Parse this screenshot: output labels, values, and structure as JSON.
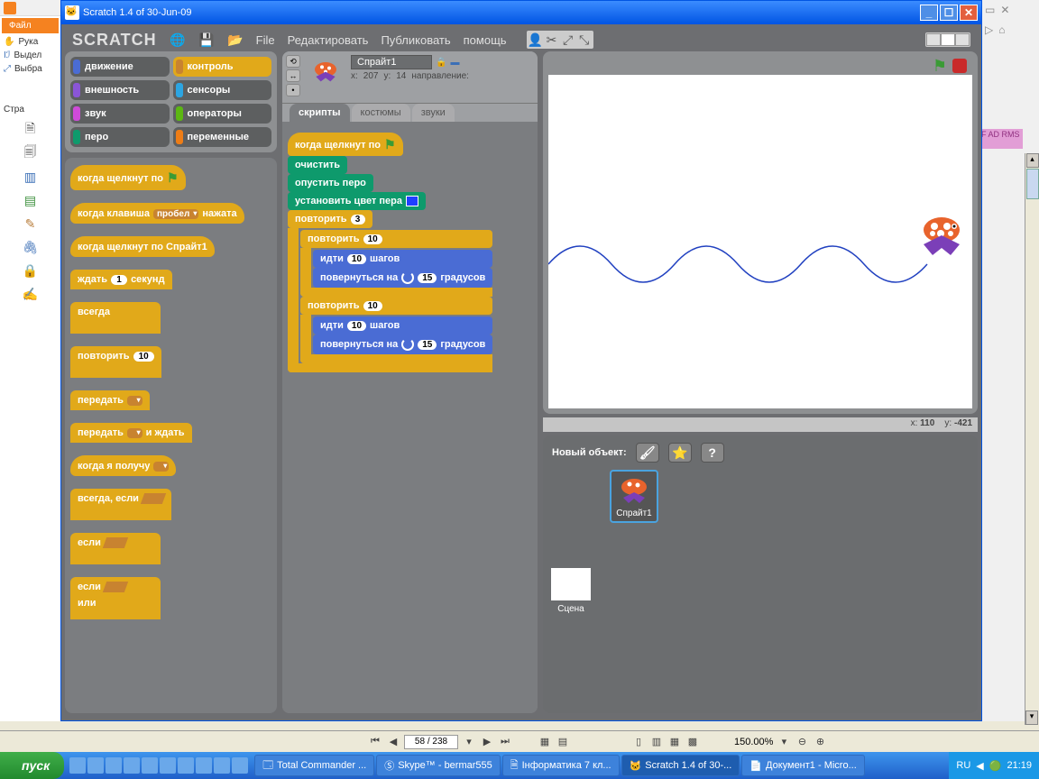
{
  "window": {
    "title": "Scratch 1.4 of 30-Jun-09"
  },
  "menubar": {
    "logo": "SCRATCH",
    "items": [
      "File",
      "Редактировать",
      "Публиковать",
      "помощь"
    ]
  },
  "categories": {
    "motion": "движение",
    "looks": "внешность",
    "sound": "звук",
    "pen": "перо",
    "control": "контроль",
    "sensing": "сенсоры",
    "operators": "операторы",
    "variables": "переменные"
  },
  "blocks": {
    "when_flag": "когда щелкнут по",
    "when_key": "когда клавиша",
    "when_key_key": "пробел",
    "when_key_suffix": "нажата",
    "when_sprite": "когда щелкнут по  Спрайт1",
    "wait": "ждать",
    "wait_n": "1",
    "wait_unit": "секунд",
    "forever": "всегда",
    "repeat": "повторить",
    "repeat_n": "10",
    "broadcast": "передать",
    "broadcast_wait": "передать",
    "broadcast_wait_suffix": "и ждать",
    "when_receive": "когда я получу",
    "forever_if": "всегда, если",
    "if": "если",
    "or": "или"
  },
  "sprite": {
    "name": "Спрайт1",
    "x_label": "x:",
    "x": "207",
    "y_label": "y:",
    "y": "14",
    "direction_label": "направление:"
  },
  "tabs": {
    "scripts": "скрипты",
    "costumes": "костюмы",
    "sounds": "звуки"
  },
  "script_stack": {
    "hat": "когда щелкнут по",
    "clear": "очистить",
    "pen_down": "опустить перо",
    "set_color": "установить цвет пера",
    "repeat_outer": "повторить",
    "repeat_outer_n": "3",
    "repeat1": "повторить",
    "repeat1_n": "10",
    "move": "идти",
    "move_n": "10",
    "move_unit": "шагов",
    "turn_r": "повернуться на",
    "turn_r_n": "15",
    "turn_r_unit": "градусов",
    "repeat2": "повторить",
    "repeat2_n": "10",
    "move2_n": "10",
    "turn_l_n": "15"
  },
  "stage": {
    "coords_x_label": "x:",
    "coords_x": "110",
    "coords_y_label": "y:",
    "coords_y": "-421",
    "new_object": "Новый объект:",
    "stage_label": "Сцена",
    "sprite_label": "Спрайт1"
  },
  "outer": {
    "file_btn": "Файл",
    "tool_hand": "Рука",
    "tool_select": "Выдел",
    "tool_pick": "Выбра",
    "page_label_prefix": "Стра",
    "page": "58 / 238",
    "zoom": "150.00%"
  },
  "bg_tab": "F\nAD RMS",
  "taskbar": {
    "start": "пуск",
    "tasks": [
      "Total Commander ...",
      "Skype™ - bermar555",
      "Інформатика 7 кл...",
      "Scratch 1.4 of 30-...",
      "Документ1 - Micro..."
    ],
    "lang": "RU",
    "time": "21:19"
  }
}
